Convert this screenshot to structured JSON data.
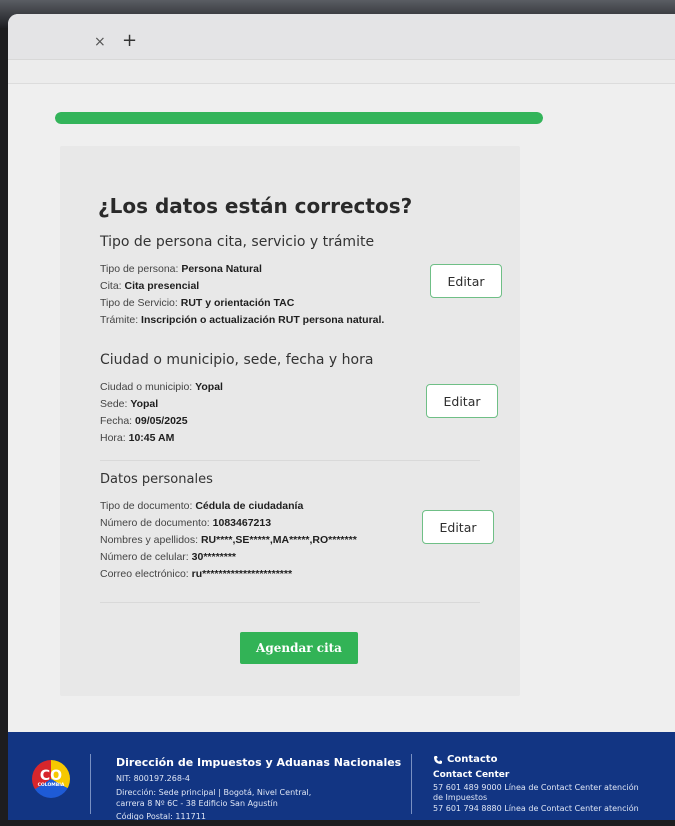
{
  "browser": {
    "close_tab_glyph": "×",
    "new_tab_glyph": "+"
  },
  "progress": {
    "fraction": 1.0,
    "color": "#33b45a"
  },
  "form": {
    "title": "¿Los datos están correctos?",
    "sections": {
      "tipo": {
        "title": "Tipo de persona cita, servicio y trámite",
        "edit_label": "Editar",
        "rows": [
          {
            "label": "Tipo de persona:",
            "value": "Persona Natural"
          },
          {
            "label": "Cita:",
            "value": "Cita presencial"
          },
          {
            "label": "Tipo de Servicio:",
            "value": "RUT y orientación TAC"
          },
          {
            "label": "Trámite:",
            "value": "Inscripción o actualización RUT persona natural."
          }
        ]
      },
      "ciudad": {
        "title": "Ciudad o municipio, sede, fecha y hora",
        "edit_label": "Editar",
        "rows": [
          {
            "label": "Ciudad o municipio:",
            "value": "Yopal"
          },
          {
            "label": "Sede:",
            "value": "Yopal"
          },
          {
            "label": "Fecha:",
            "value": "09/05/2025"
          },
          {
            "label": "Hora:",
            "value": "10:45 AM"
          }
        ]
      },
      "personales": {
        "title": "Datos personales",
        "edit_label": "Editar",
        "rows": [
          {
            "label": "Tipo de documento:",
            "value": "Cédula de ciudadanía"
          },
          {
            "label": "Número de documento:",
            "value": "1083467213"
          },
          {
            "label": "Nombres y apellidos:",
            "value": "RU****,SE*****,MA*****,RO*******"
          },
          {
            "label": "Número de celular:",
            "value": "30********"
          },
          {
            "label": "Correo electrónico:",
            "value": "ru**********************"
          }
        ]
      }
    },
    "submit_label": "Agendar cita"
  },
  "footer": {
    "logo_main": "CO",
    "logo_sub": "COLOMBIA",
    "org_name": "Dirección de Impuestos y Aduanas Nacionales",
    "nit": "NIT: 800197.268-4",
    "address_1": "Dirección: Sede principal | Bogotá, Nivel Central,",
    "address_2": "carrera 8 Nº 6C - 38 Edificio San Agustín",
    "postal": "Código Postal: 111711",
    "contact_title": "Contacto",
    "contact_center": "Contact Center",
    "phone_1": "57 601 489 9000 Línea de Contact Center atención",
    "phone_1b": "de Impuestos",
    "phone_2": "57 601 794 8880 Línea de Contact Center atención"
  },
  "colors": {
    "primary": "#32b356",
    "footer_bg": "#123583",
    "edit_border": "#6fbf86"
  }
}
